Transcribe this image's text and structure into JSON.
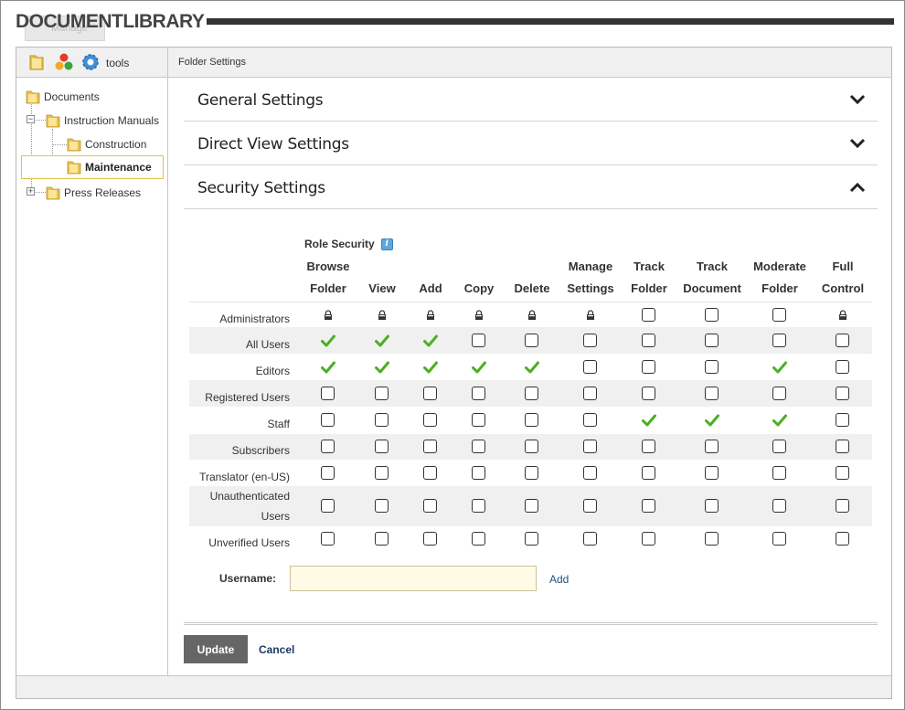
{
  "header": {
    "title": "DOCUMENTLIBRARY",
    "manage_label": "Manage"
  },
  "toolbar": {
    "tools_label": "tools",
    "folder_settings_label": "Folder Settings"
  },
  "tree": {
    "root": "Documents",
    "items": [
      {
        "label": "Instruction Manuals",
        "expanded": true
      },
      {
        "label": "Construction"
      },
      {
        "label": "Maintenance",
        "selected": true
      },
      {
        "label": "Press Releases",
        "expanded": false
      }
    ]
  },
  "sections": {
    "general": "General Settings",
    "direct_view": "Direct View Settings",
    "security": "Security Settings"
  },
  "security": {
    "role_security_label": "Role Security",
    "columns": [
      [
        "Browse",
        "Folder"
      ],
      [
        "",
        "View"
      ],
      [
        "",
        "Add"
      ],
      [
        "",
        "Copy"
      ],
      [
        "",
        "Delete"
      ],
      [
        "Manage",
        "Settings"
      ],
      [
        "Track",
        "Folder"
      ],
      [
        "Track",
        "Document"
      ],
      [
        "Moderate",
        "Folder"
      ],
      [
        "Full",
        "Control"
      ]
    ],
    "rows": [
      {
        "role": "Administrators",
        "perms": [
          "lock",
          "lock",
          "lock",
          "lock",
          "lock",
          "lock",
          "off",
          "off",
          "off",
          "lock"
        ]
      },
      {
        "role": "All Users",
        "perms": [
          "on",
          "on",
          "on",
          "off",
          "off",
          "off",
          "off",
          "off",
          "off",
          "off"
        ]
      },
      {
        "role": "Editors",
        "perms": [
          "on",
          "on",
          "on",
          "on",
          "on",
          "off",
          "off",
          "off",
          "on",
          "off"
        ]
      },
      {
        "role": "Registered Users",
        "perms": [
          "off",
          "off",
          "off",
          "off",
          "off",
          "off",
          "off",
          "off",
          "off",
          "off"
        ]
      },
      {
        "role": "Staff",
        "perms": [
          "off",
          "off",
          "off",
          "off",
          "off",
          "off",
          "on",
          "on",
          "on",
          "off"
        ]
      },
      {
        "role": "Subscribers",
        "perms": [
          "off",
          "off",
          "off",
          "off",
          "off",
          "off",
          "off",
          "off",
          "off",
          "off"
        ]
      },
      {
        "role": "Translator (en-US)",
        "perms": [
          "off",
          "off",
          "off",
          "off",
          "off",
          "off",
          "off",
          "off",
          "off",
          "off"
        ]
      },
      {
        "role": "Unauthenticated Users",
        "role_lines": [
          "Unauthenticated",
          "Users"
        ],
        "perms": [
          "off",
          "off",
          "off",
          "off",
          "off",
          "off",
          "off",
          "off",
          "off",
          "off"
        ]
      },
      {
        "role": "Unverified Users",
        "perms": [
          "off",
          "off",
          "off",
          "off",
          "off",
          "off",
          "off",
          "off",
          "off",
          "off"
        ]
      }
    ],
    "username_label": "Username:",
    "username_value": "",
    "add_label": "Add"
  },
  "actions": {
    "update_label": "Update",
    "cancel_label": "Cancel"
  },
  "colors": {
    "check_green": "#4caf22",
    "accent_dark": "#333333"
  }
}
